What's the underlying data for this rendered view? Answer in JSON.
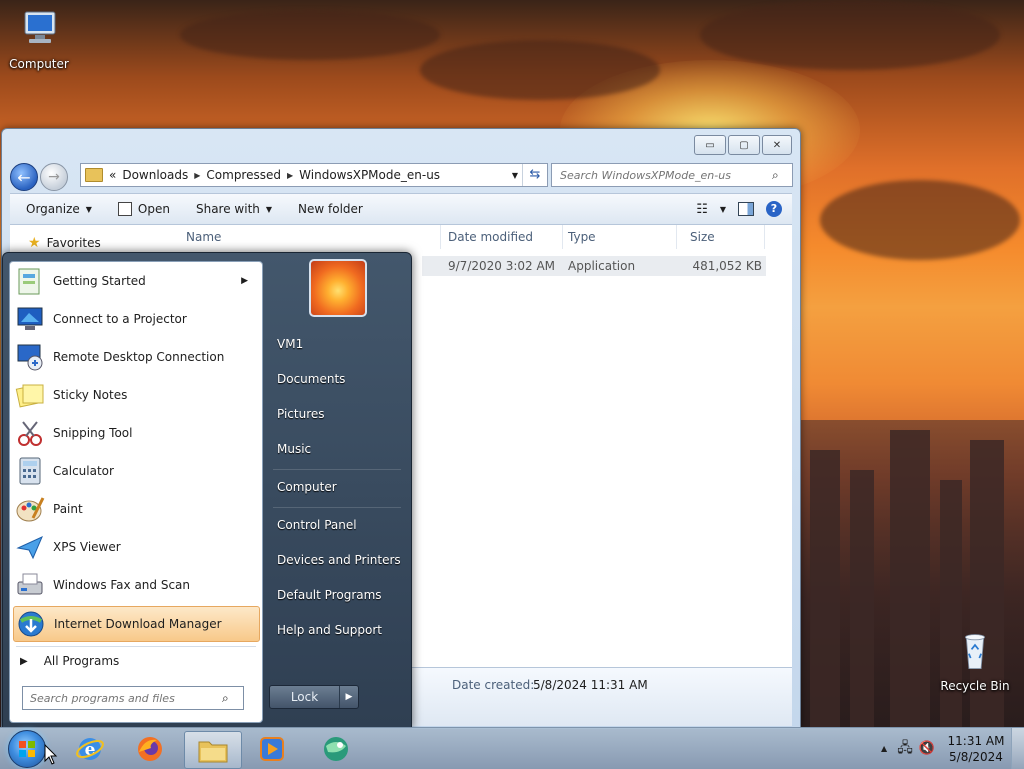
{
  "desktop": {
    "icons": [
      {
        "label": "Computer"
      },
      {
        "label": "Recycle Bin"
      }
    ]
  },
  "explorer": {
    "window_buttons": {
      "minimize": "▭",
      "maximize": "▢",
      "close": "✕"
    },
    "address": {
      "history_marker": "«",
      "crumbs": [
        "Downloads",
        "Compressed",
        "WindowsXPMode_en-us"
      ]
    },
    "search_placeholder": "Search WindowsXPMode_en-us",
    "toolbar": {
      "organize": "Organize",
      "open": "Open",
      "share_with": "Share with",
      "new_folder": "New folder",
      "help": "?"
    },
    "nav": {
      "favorites": "Favorites"
    },
    "columns": [
      "Name",
      "Date modified",
      "Type",
      "Size"
    ],
    "files": [
      {
        "date_modified": "9/7/2020 3:02 AM",
        "type": "Application",
        "size": "481,052 KB"
      }
    ],
    "details": {
      "label": "Date created:",
      "value": "5/8/2024 11:31 AM"
    }
  },
  "start_menu": {
    "programs": [
      {
        "label": "Getting Started",
        "has_submenu": true
      },
      {
        "label": "Connect to a Projector"
      },
      {
        "label": "Remote Desktop Connection"
      },
      {
        "label": "Sticky Notes"
      },
      {
        "label": "Snipping Tool"
      },
      {
        "label": "Calculator"
      },
      {
        "label": "Paint"
      },
      {
        "label": "XPS Viewer"
      },
      {
        "label": "Windows Fax and Scan"
      },
      {
        "label": "Internet Download Manager",
        "highlighted": true
      }
    ],
    "all_programs": "All Programs",
    "search_placeholder": "Search programs and files",
    "right_links": [
      "VM1",
      "Documents",
      "Pictures",
      "Music",
      "Computer",
      "Control Panel",
      "Devices and Printers",
      "Default Programs",
      "Help and Support"
    ],
    "lock_label": "Lock"
  },
  "taskbar": {
    "clock_time": "11:31 AM",
    "clock_date": "5/8/2024"
  },
  "colors": {
    "accent_blue": "#2a64c6",
    "highlight": "#f8c98a",
    "start_menu_bg": "#3a4b60"
  }
}
